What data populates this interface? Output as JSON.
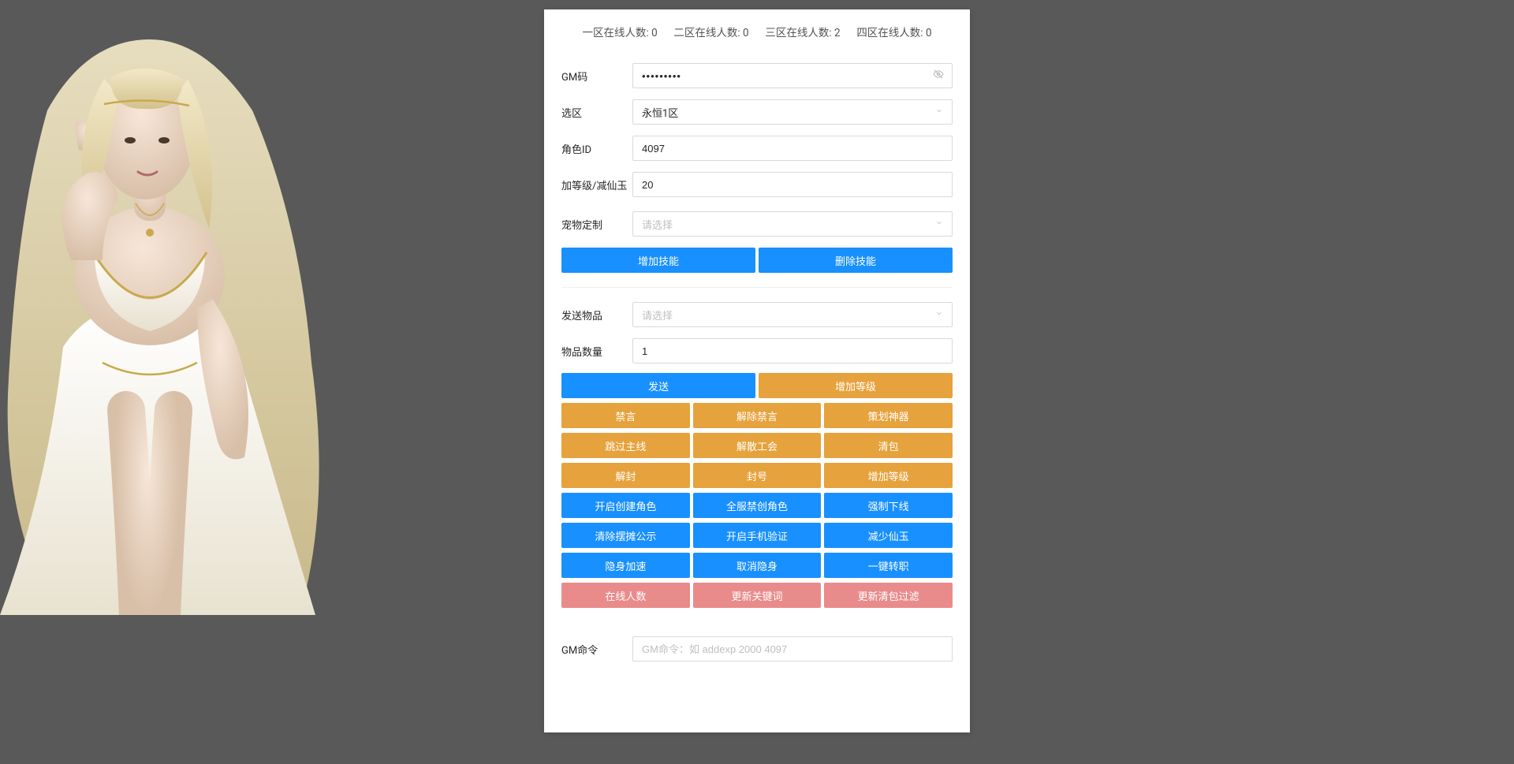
{
  "status": {
    "zone1": {
      "label": "一区在线人数:",
      "value": "0"
    },
    "zone2": {
      "label": "二区在线人数:",
      "value": "0"
    },
    "zone3": {
      "label": "三区在线人数:",
      "value": "2"
    },
    "zone4": {
      "label": "四区在线人数:",
      "value": "0"
    }
  },
  "form": {
    "gm_code": {
      "label": "GM码",
      "value": "•••••••••"
    },
    "zone_select": {
      "label": "选区",
      "value": "永恒1区"
    },
    "role_id": {
      "label": "角色ID",
      "value": "4097"
    },
    "level_jade": {
      "label": "加等级/减仙玉",
      "value": "20"
    },
    "pet_custom": {
      "label": "宠物定制",
      "placeholder": "请选择"
    },
    "send_item": {
      "label": "发送物品",
      "placeholder": "请选择"
    },
    "item_qty": {
      "label": "物品数量",
      "value": "1"
    },
    "gm_cmd": {
      "label": "GM命令",
      "placeholder": "GM命令：如 addexp 2000 4097"
    }
  },
  "buttons": {
    "add_skill": "增加技能",
    "del_skill": "删除技能",
    "send": "发送",
    "add_level_top": "增加等级",
    "row_a": [
      "禁言",
      "解除禁言",
      "策划神器"
    ],
    "row_b": [
      "跳过主线",
      "解散工会",
      "清包"
    ],
    "row_c": [
      "解封",
      "封号",
      "增加等级"
    ],
    "row_d": [
      "开启创建角色",
      "全服禁创角色",
      "强制下线"
    ],
    "row_e": [
      "清除摆摊公示",
      "开启手机验证",
      "减少仙玉"
    ],
    "row_f": [
      "隐身加速",
      "取消隐身",
      "一键转职"
    ],
    "row_g": [
      "在线人数",
      "更新关键词",
      "更新清包过滤"
    ]
  }
}
